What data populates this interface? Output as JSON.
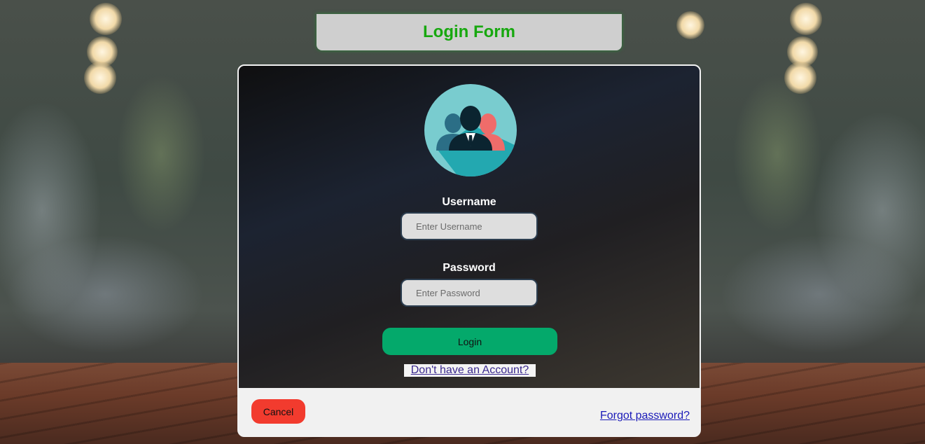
{
  "header": {
    "title": "Login Form"
  },
  "form": {
    "avatar_icon": "users-group-icon",
    "username": {
      "label": "Username",
      "placeholder": "Enter Username",
      "value": ""
    },
    "password": {
      "label": "Password",
      "placeholder": "Enter Password",
      "value": ""
    },
    "login_label": "Login",
    "signup_link": "Don't have an Account?"
  },
  "footer": {
    "cancel_label": "Cancel",
    "forgot_link": "Forgot password?"
  },
  "colors": {
    "title": "#17a80f",
    "login_button": "#04a96b",
    "cancel_button": "#f23b2e",
    "link": "#1a1ab8"
  }
}
